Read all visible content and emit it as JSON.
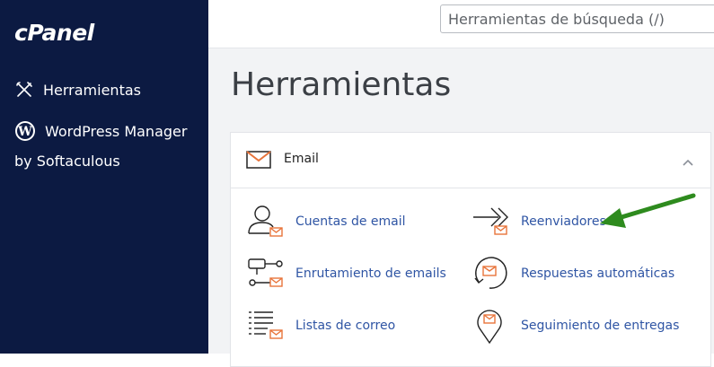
{
  "sidebar": {
    "logo": "cPanel",
    "items": [
      {
        "label": "Herramientas",
        "icon": "tools-icon"
      },
      {
        "label": "WordPress Manager",
        "label2": "by Softaculous",
        "icon": "wordpress-icon"
      }
    ]
  },
  "header": {
    "search": {
      "placeholder": "Herramientas de búsqueda (/)"
    }
  },
  "main": {
    "title": "Herramientas",
    "section": {
      "title": "Email",
      "icon": "envelope-icon",
      "tools": [
        {
          "label": "Cuentas de email",
          "icon": "email-accounts-icon"
        },
        {
          "label": "Reenviadores",
          "icon": "forwarders-icon"
        },
        {
          "label": "Enrutamiento de emails",
          "icon": "email-routing-icon"
        },
        {
          "label": "Respuestas automáticas",
          "icon": "autoresponders-icon"
        },
        {
          "label": "Listas de correo",
          "icon": "mailing-lists-icon"
        },
        {
          "label": "Seguimiento de entregas",
          "icon": "track-delivery-icon"
        }
      ]
    }
  },
  "colors": {
    "sidebar_bg": "#0c1a42",
    "link": "#2f55a4",
    "accent_orange": "#e8743b",
    "annotation_arrow": "#2e8b1e"
  }
}
